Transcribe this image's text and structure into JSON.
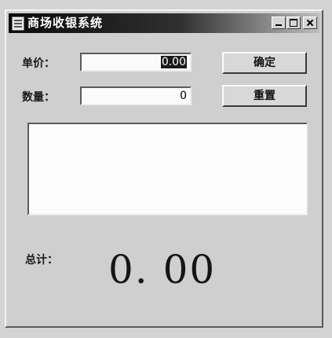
{
  "window": {
    "title": "商场收银系统",
    "controls": [
      "minimize-icon",
      "maximize-icon",
      "close-icon"
    ]
  },
  "form": {
    "unit_price_label": "单价：",
    "unit_price_value": "0.00",
    "quantity_label": "数量：",
    "quantity_value": "0"
  },
  "buttons": {
    "confirm_label": "确定",
    "reset_label": "重置"
  },
  "list": {
    "items": []
  },
  "total": {
    "label": "总计：",
    "value": "0. 00"
  }
}
